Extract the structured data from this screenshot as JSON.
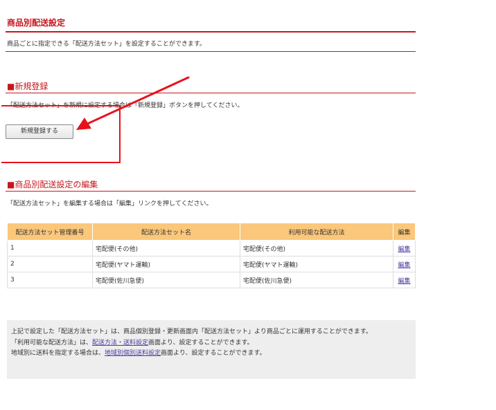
{
  "page_title": "商品別配送設定",
  "page_desc": "商品ごとに指定できる「配送方法セット」を設定することができます。",
  "new_section": {
    "title": "■新規登録",
    "desc": "「配送方法セット」を新規に設定する場合は「新規登録」ボタンを押してください。",
    "button_label": "新規登録する"
  },
  "edit_section": {
    "title": "■商品別配送設定の編集",
    "desc": "「配送方法セット」を編集する場合は「編集」リンクを押してください。"
  },
  "table": {
    "headers": [
      "配送方法セット管理番号",
      "配送方法セット名",
      "利用可能な配送方法",
      "編集"
    ],
    "rows": [
      {
        "id": "1",
        "name": "宅配便(その他)",
        "methods": "宅配便(その他)",
        "edit": "編集"
      },
      {
        "id": "2",
        "name": "宅配便(ヤマト運輸)",
        "methods": "宅配便(ヤマト運輸)",
        "edit": "編集"
      },
      {
        "id": "3",
        "name": "宅配便(佐川急便)",
        "methods": "宅配便(佐川急便)",
        "edit": "編集"
      }
    ]
  },
  "info": {
    "line1": "上記で設定した「配送方法セット」は、商品個別登録・更新画面内「配送方法セット」より商品ごとに運用することができます。",
    "line2_prefix": "「利用可能な配送方法」は、",
    "line2_link": "配送方法・送料設定",
    "line2_suffix": "画面より、設定することができます。",
    "line3_prefix": "地域別に送料を指定する場合は、",
    "line3_link": "地域別個別送料設定",
    "line3_suffix": "画面より、設定することができます。"
  },
  "colors": {
    "accent": "#c8161d",
    "table_header": "#fbc77a",
    "annotation": "#e8111a"
  }
}
